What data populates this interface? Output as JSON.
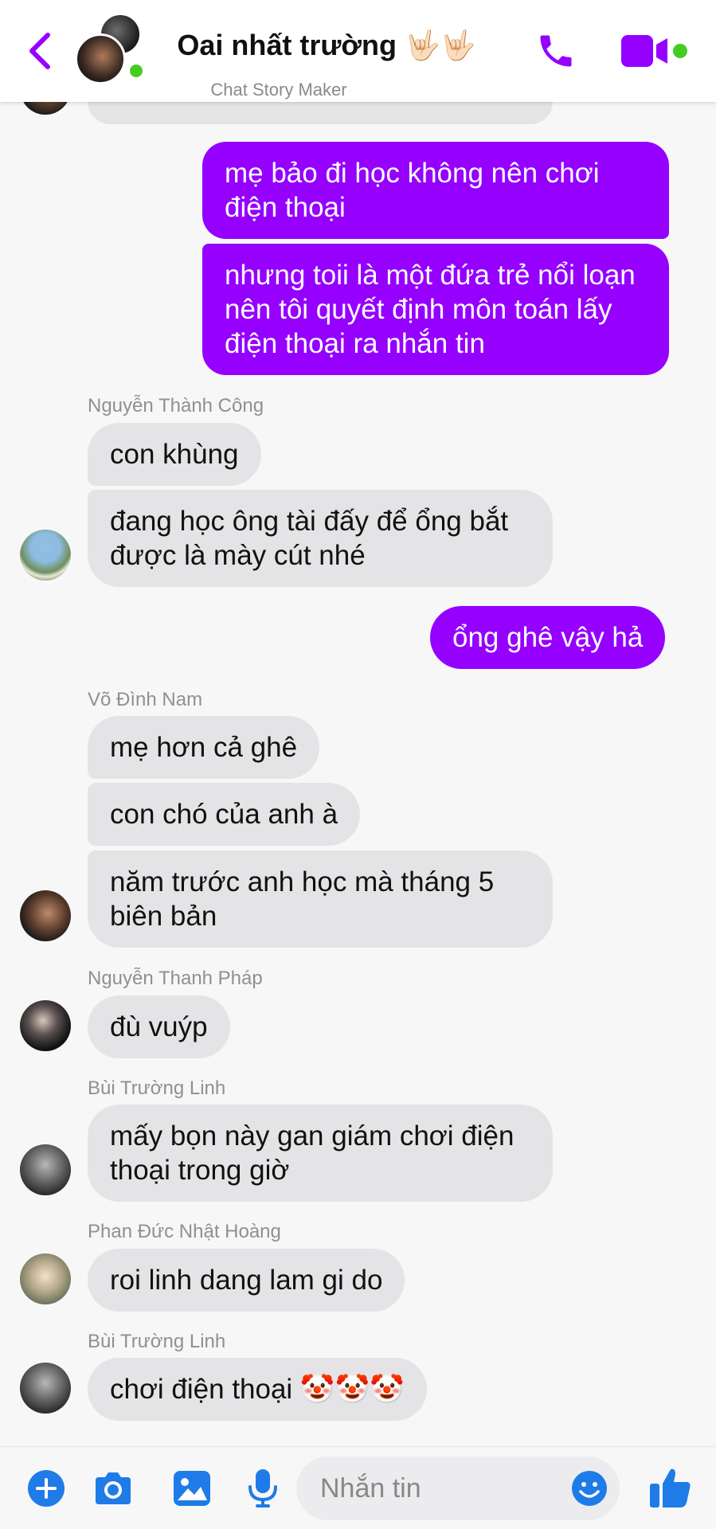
{
  "colors": {
    "accent": "#9500ff",
    "blue_icon": "#1f7be8",
    "online": "#44cc22",
    "bubble_in": "#e4e4e6",
    "bubble_out": "#9500ff"
  },
  "header": {
    "title": "Oai nhất trường 🤟🏻🤟🏻",
    "subtitle": "Chat Story Maker",
    "icons": [
      "back-chevron-icon",
      "phone-icon",
      "video-camera-icon"
    ]
  },
  "messages": [
    {
      "dir": "out",
      "text": "mẹ bảo đi học không nên chơi điện thoại"
    },
    {
      "dir": "out",
      "text": "nhưng toii là một đứa trẻ nổi loạn nên tôi quyết định môn toán lấy điện thoại ra nhắn tin"
    },
    {
      "sender": "Nguyễn Thành Công"
    },
    {
      "dir": "in",
      "text": "con khùng"
    },
    {
      "dir": "in",
      "text": "đang học ông tài đấy để ổng bắt được là mày cút nhé"
    },
    {
      "dir": "out",
      "text": "ổng ghê vậy hả"
    },
    {
      "sender": "Võ Đình Nam"
    },
    {
      "dir": "in",
      "text": "mẹ hơn cả ghê"
    },
    {
      "dir": "in",
      "text": "con chó của anh à"
    },
    {
      "dir": "in",
      "text": "năm trước anh học mà tháng 5 biên bản"
    },
    {
      "sender": "Nguyễn Thanh Pháp"
    },
    {
      "dir": "in",
      "text": "đù vuýp"
    },
    {
      "sender": "Bùi Trường Linh"
    },
    {
      "dir": "in",
      "text": "mấy bọn này gan giám chơi điện thoại trong giờ"
    },
    {
      "sender": "Phan Đức Nhật Hoàng"
    },
    {
      "dir": "in",
      "text": "roi linh dang lam gi do"
    },
    {
      "sender": "Bùi Trường Linh"
    },
    {
      "dir": "in",
      "text": "chơi điện thoại 🤡🤡🤡"
    }
  ],
  "composer": {
    "placeholder": "Nhắn tin",
    "icons": [
      "plus-icon",
      "camera-icon",
      "image-icon",
      "microphone-icon",
      "emoji-icon",
      "thumbs-up-icon"
    ]
  }
}
